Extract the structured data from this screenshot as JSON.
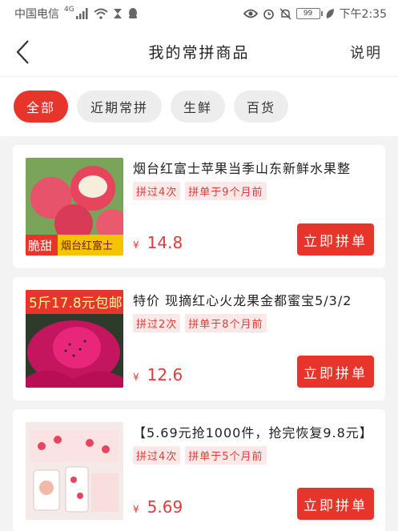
{
  "status": {
    "carrier": "中国电信",
    "network": "4G",
    "battery": "99",
    "time": "下午2:35"
  },
  "header": {
    "title": "我的常拼商品",
    "help": "说明"
  },
  "tabs": [
    {
      "label": "全部",
      "active": true
    },
    {
      "label": "近期常拼",
      "active": false
    },
    {
      "label": "生鲜",
      "active": false
    },
    {
      "label": "百货",
      "active": false
    }
  ],
  "products": [
    {
      "name": "烟台红富士苹果当季山东新鲜水果整",
      "tag_count": "拼过4次",
      "tag_time": "拼单于9个月前",
      "currency": "¥",
      "price": "14.8",
      "button": "立即拼单",
      "image_text_a": "脆甜",
      "image_text_b": "烟台红富士"
    },
    {
      "name": "特价 现摘红心火龙果金都蜜宝5/3/2",
      "tag_count": "拼过2次",
      "tag_time": "拼单于8个月前",
      "currency": "¥",
      "price": "12.6",
      "button": "立即拼单",
      "image_text_a": "5斤17.8元包邮"
    },
    {
      "name": "【5.69元抢1000件，抢完恢复9.8元】",
      "tag_count": "拼过4次",
      "tag_time": "拼单于5个月前",
      "currency": "¥",
      "price": "5.69",
      "button": "立即拼单"
    }
  ],
  "colors": {
    "accent": "#e8352b",
    "tag_bg": "#fde8e8"
  }
}
